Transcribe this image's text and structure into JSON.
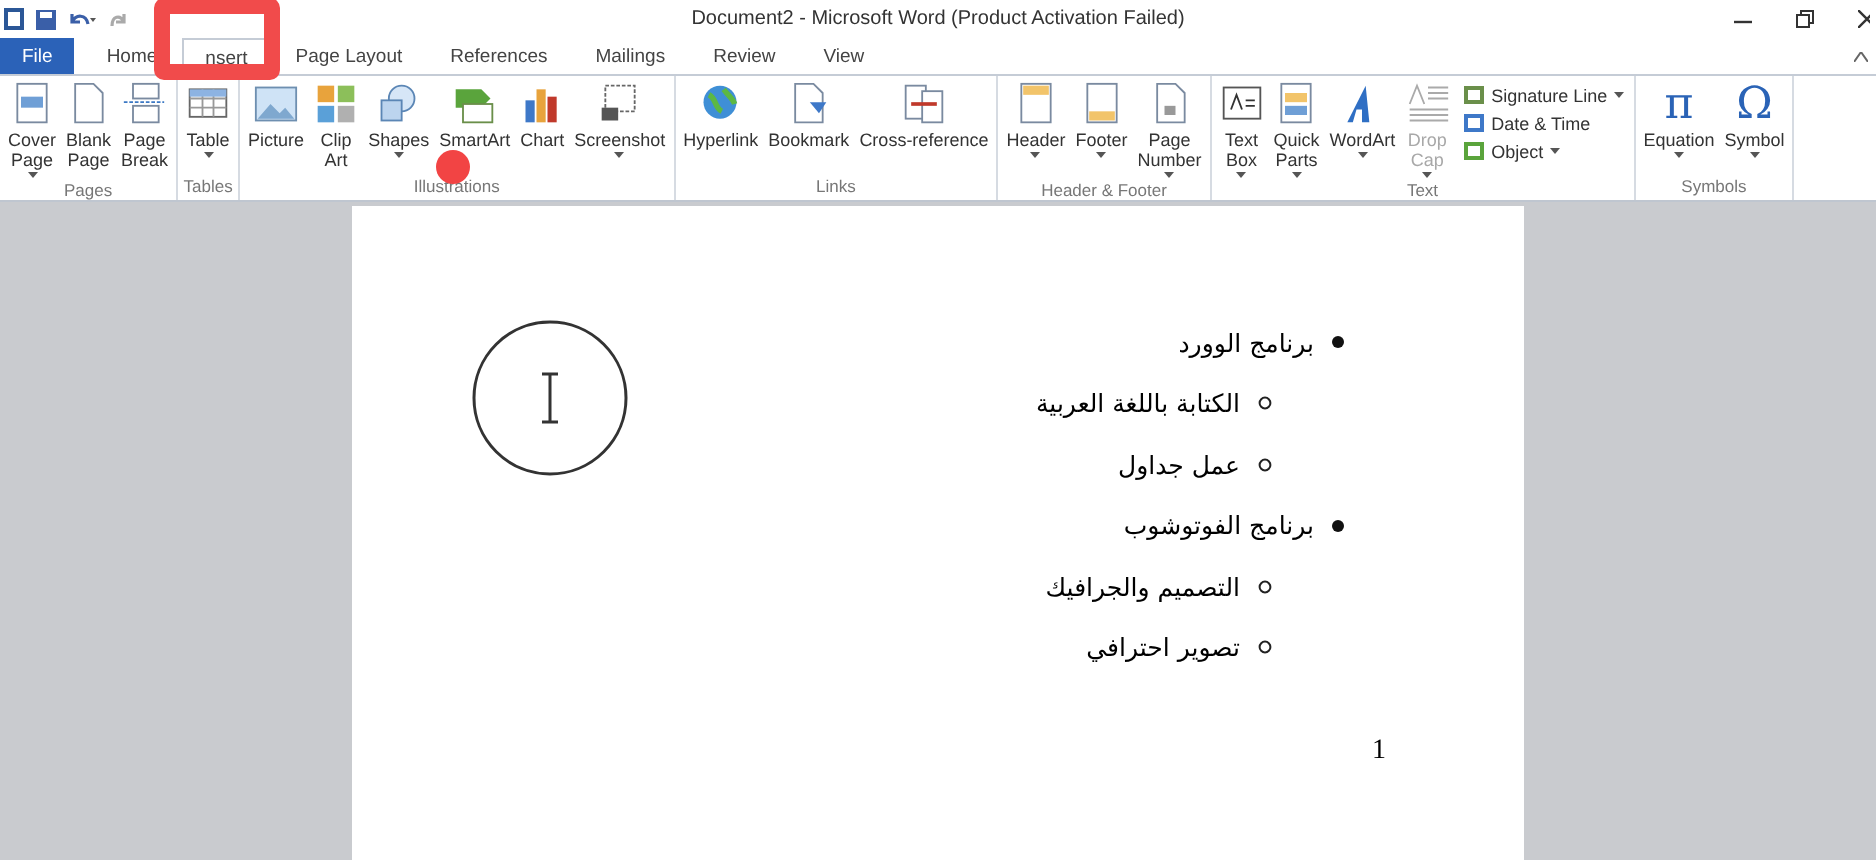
{
  "window": {
    "title": "Document2 - Microsoft Word (Product Activation Failed)"
  },
  "tabs": [
    {
      "label": "File",
      "kind": "file",
      "selected": false,
      "highlighted": false
    },
    {
      "label": "Home",
      "kind": "tab",
      "selected": false,
      "highlighted": false
    },
    {
      "label": "nsert",
      "kind": "tab",
      "selected": true,
      "highlighted": true
    },
    {
      "label": "Page Layout",
      "kind": "tab",
      "selected": false,
      "highlighted": false
    },
    {
      "label": "References",
      "kind": "tab",
      "selected": false,
      "highlighted": false
    },
    {
      "label": "Mailings",
      "kind": "tab",
      "selected": false,
      "highlighted": false
    },
    {
      "label": "Review",
      "kind": "tab",
      "selected": false,
      "highlighted": false
    },
    {
      "label": "View",
      "kind": "tab",
      "selected": false,
      "highlighted": false
    }
  ],
  "ribbon": {
    "groups": [
      {
        "label": "Pages",
        "click_marker": false,
        "buttons": [
          {
            "lines": [
              "Cover",
              "Page"
            ],
            "dropdown": true,
            "disabled": false
          },
          {
            "lines": [
              "Blank",
              "Page"
            ],
            "dropdown": false,
            "disabled": false
          },
          {
            "lines": [
              "Page",
              "Break"
            ],
            "dropdown": false,
            "disabled": false
          }
        ]
      },
      {
        "label": "Tables",
        "click_marker": false,
        "buttons": [
          {
            "lines": [
              "Table"
            ],
            "dropdown": true,
            "disabled": false
          }
        ]
      },
      {
        "label": "Illustrations",
        "click_marker": true,
        "buttons": [
          {
            "lines": [
              "Picture"
            ],
            "dropdown": false,
            "disabled": false
          },
          {
            "lines": [
              "Clip",
              "Art"
            ],
            "dropdown": false,
            "disabled": false
          },
          {
            "lines": [
              "Shapes"
            ],
            "dropdown": true,
            "disabled": false
          },
          {
            "lines": [
              "SmartArt"
            ],
            "dropdown": false,
            "disabled": false
          },
          {
            "lines": [
              "Chart"
            ],
            "dropdown": false,
            "disabled": false
          },
          {
            "lines": [
              "Screenshot"
            ],
            "dropdown": true,
            "disabled": false
          }
        ]
      },
      {
        "label": "Links",
        "click_marker": false,
        "buttons": [
          {
            "lines": [
              "Hyperlink"
            ],
            "dropdown": false,
            "disabled": false
          },
          {
            "lines": [
              "Bookmark"
            ],
            "dropdown": false,
            "disabled": false
          },
          {
            "lines": [
              "Cross-reference"
            ],
            "dropdown": false,
            "disabled": false
          }
        ]
      },
      {
        "label": "Header & Footer",
        "click_marker": false,
        "buttons": [
          {
            "lines": [
              "Header"
            ],
            "dropdown": true,
            "disabled": false
          },
          {
            "lines": [
              "Footer"
            ],
            "dropdown": true,
            "disabled": false
          },
          {
            "lines": [
              "Page",
              "Number"
            ],
            "dropdown": true,
            "disabled": false
          }
        ]
      },
      {
        "label": "Text",
        "click_marker": false,
        "buttons": [
          {
            "lines": [
              "Text",
              "Box"
            ],
            "dropdown": true,
            "disabled": false
          },
          {
            "lines": [
              "Quick",
              "Parts"
            ],
            "dropdown": true,
            "disabled": false
          },
          {
            "lines": [
              "WordArt"
            ],
            "dropdown": true,
            "disabled": false
          },
          {
            "lines": [
              "Drop",
              "Cap"
            ],
            "dropdown": true,
            "disabled": true
          }
        ],
        "small_buttons": [
          {
            "label": "Signature Line",
            "dropdown": true
          },
          {
            "label": "Date & Time",
            "dropdown": false
          },
          {
            "label": "Object",
            "dropdown": true
          }
        ]
      },
      {
        "label": "Symbols",
        "click_marker": false,
        "buttons": [
          {
            "lines": [
              "Equation"
            ],
            "dropdown": true,
            "disabled": false,
            "glyph": "π"
          },
          {
            "lines": [
              "Symbol"
            ],
            "dropdown": true,
            "disabled": false,
            "glyph": "Ω"
          }
        ]
      }
    ]
  },
  "document": {
    "cursor_highlight": true,
    "list": [
      {
        "text": "برنامج الوورد",
        "children": [
          {
            "text": "الكتابة باللغة العربية"
          },
          {
            "text": "عمل جداول"
          }
        ]
      },
      {
        "text": "برنامج الفوتوشوب",
        "children": [
          {
            "text": "التصميم والجرافيك"
          },
          {
            "text": "تصوير احترافي"
          }
        ]
      }
    ],
    "page_number": "1"
  }
}
